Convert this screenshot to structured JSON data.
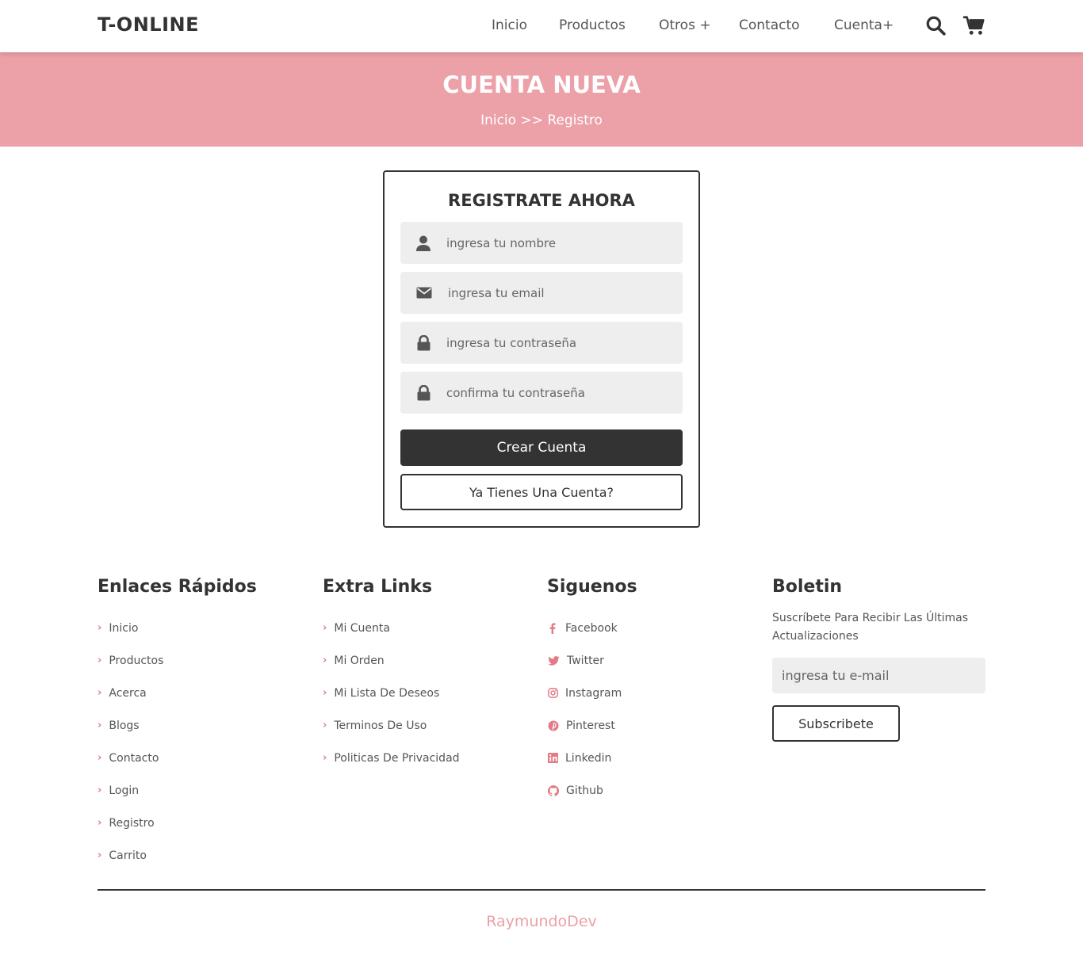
{
  "header": {
    "logo": "T-ONLINE",
    "nav": [
      "Inicio",
      "Productos",
      "Otros +",
      "Contacto",
      "Cuenta+"
    ]
  },
  "banner": {
    "title": "CUENTA NUEVA",
    "breadcrumb": "Inicio >> Registro"
  },
  "form": {
    "title": "REGISTRATE AHORA",
    "name_placeholder": "ingresa tu nombre",
    "email_placeholder": "ingresa tu email",
    "password_placeholder": "ingresa tu contraseña",
    "confirm_placeholder": "confirma tu contraseña",
    "submit_label": "Crear Cuenta",
    "login_label": "Ya Tienes Una Cuenta?"
  },
  "footer": {
    "quick": {
      "title": "Enlaces Rápidos",
      "items": [
        "Inicio",
        "Productos",
        "Acerca",
        "Blogs",
        "Contacto",
        "Login",
        "Registro",
        "Carrito"
      ]
    },
    "extra": {
      "title": "Extra Links",
      "items": [
        "Mi Cuenta",
        "Mi Orden",
        "Mi Lista De Deseos",
        "Terminos De Uso",
        "Politicas De Privacidad"
      ]
    },
    "social": {
      "title": "Siguenos",
      "items": [
        "Facebook",
        "Twitter",
        "Instagram",
        "Pinterest",
        "Linkedin",
        "Github"
      ]
    },
    "newsletter": {
      "title": "Boletin",
      "text": "Suscríbete Para Recibir Las Últimas Actualizaciones",
      "placeholder": "ingresa tu e-mail",
      "button": "Subscribete"
    },
    "credit": "RaymundoDev"
  },
  "colors": {
    "accent": "#eca0a7",
    "dark": "#333333",
    "field": "#eeeeee"
  }
}
